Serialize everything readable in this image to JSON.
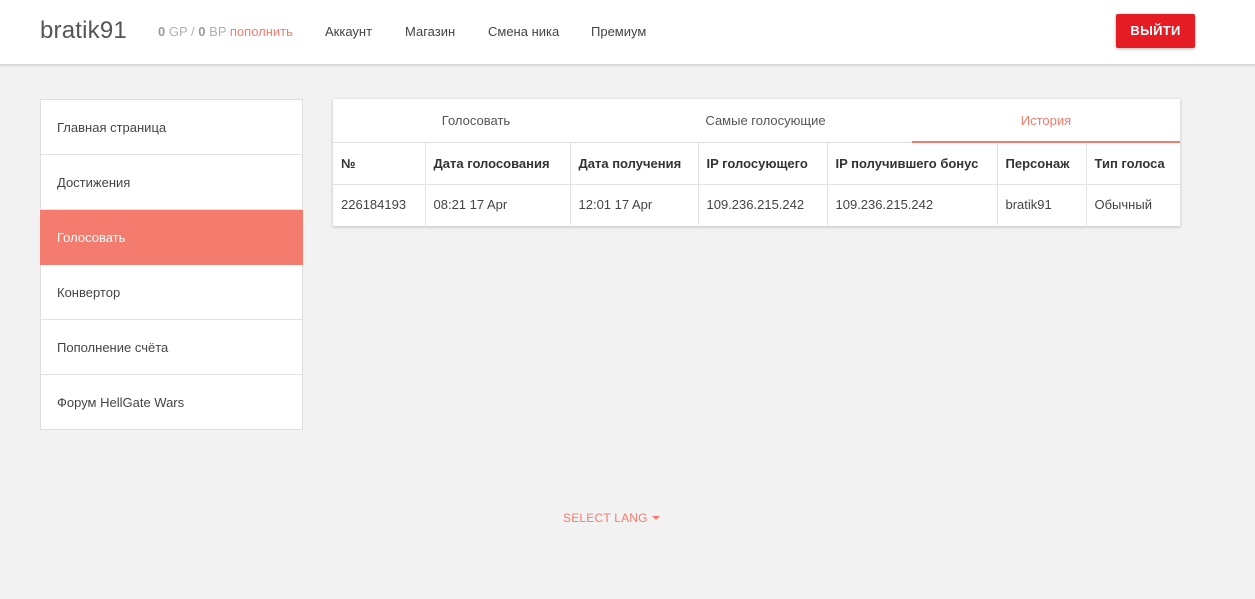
{
  "header": {
    "username": "bratik91",
    "balance": {
      "gp_value": "0",
      "gp_unit": "GP",
      "separator": "/",
      "bp_value": "0",
      "bp_unit": "BP",
      "topup_label": "пополнить"
    },
    "nav": [
      "Аккаунт",
      "Магазин",
      "Смена ника",
      "Премиум"
    ],
    "logout_label": "ВЫЙТИ"
  },
  "sidebar": {
    "items": [
      {
        "label": "Главная страница",
        "active": false
      },
      {
        "label": "Достижения",
        "active": false
      },
      {
        "label": "Голосовать",
        "active": true
      },
      {
        "label": "Конвертор",
        "active": false
      },
      {
        "label": "Пополнение счёта",
        "active": false
      },
      {
        "label": "Форум HellGate Wars",
        "active": false
      }
    ]
  },
  "main": {
    "tabs": [
      {
        "label": "Голосовать",
        "active": false
      },
      {
        "label": "Самые голосующие",
        "active": false
      },
      {
        "label": "История",
        "active": true
      }
    ],
    "table": {
      "columns": [
        "№",
        "Дата голосования",
        "Дата получения",
        "IP голосующего",
        "IP получившего бонус",
        "Персонаж",
        "Тип голоса"
      ],
      "rows": [
        [
          "226184193",
          "08:21 17 Apr",
          "12:01 17 Apr",
          "109.236.215.242",
          "109.236.215.242",
          "bratik91",
          "Обычный"
        ]
      ]
    }
  },
  "footer": {
    "lang_label": "SELECT LANG"
  },
  "colors": {
    "accent": "#f47c6e",
    "logout": "#e51c23",
    "background": "#f2f2f2"
  }
}
